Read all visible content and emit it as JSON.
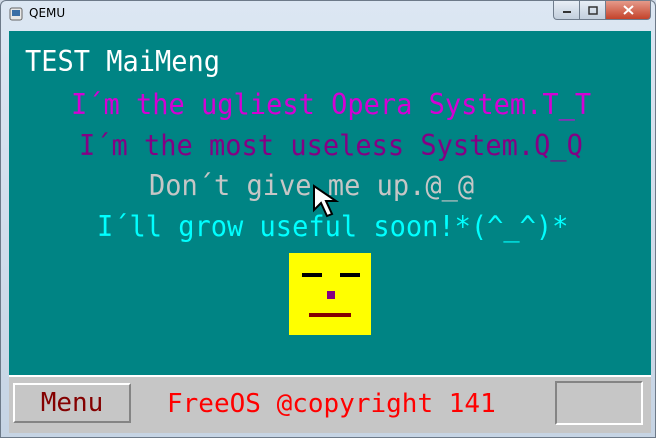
{
  "window": {
    "title": "QEMU",
    "controls": {
      "minimize": "—",
      "maximize": "□",
      "close": "✕"
    }
  },
  "screen": {
    "heading": "TEST MaiMeng",
    "lines": [
      {
        "text": "I´m the ugliest Opera System.T_T",
        "color": "#d400d4"
      },
      {
        "text": "I´m the most useless System.Q_Q",
        "color": "#840084"
      },
      {
        "text": "Don´t give me up.@_@",
        "color": "#c6c6c6"
      },
      {
        "text": "I´ll grow useful soon!*(^_^)*",
        "color": "#00ffff"
      }
    ],
    "background": "#008484",
    "face_color": "#ffff00"
  },
  "taskbar": {
    "menu_label": "Menu",
    "copyright": "FreeOS @copyright 141"
  }
}
